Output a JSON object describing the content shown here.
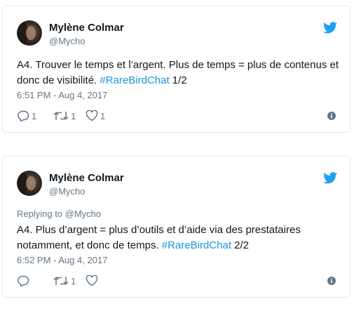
{
  "tweets": [
    {
      "author_name": "Mylène Colmar",
      "author_handle": "@Mycho",
      "replying_to": "",
      "text_before": "A4. Trouver le temps et l’argent. Plus de temps = plus de contenus et donc de visibilité. ",
      "hashtag": "#RareBirdChat",
      "text_after": " 1/2",
      "timestamp": "6:51 PM - Aug 4, 2017",
      "reply_count": "1",
      "retweet_count": "1",
      "like_count": "1"
    },
    {
      "author_name": "Mylène Colmar",
      "author_handle": "@Mycho",
      "replying_to": "Replying to @Mycho",
      "text_before": "A4. Plus d’argent = plus d’outils et d’aide via des prestataires notamment, et donc de temps. ",
      "hashtag": "#RareBirdChat",
      "text_after": " 2/2",
      "timestamp": "6:52 PM - Aug 4, 2017",
      "reply_count": "",
      "retweet_count": "1",
      "like_count": ""
    }
  ],
  "icons": {
    "brand": "twitter-bird-icon",
    "reply": "reply-icon",
    "retweet": "retweet-icon",
    "like": "heart-icon",
    "info": "info-icon"
  },
  "colors": {
    "twitter_blue": "#1da1f2",
    "hashtag": "#1b95e0",
    "secondary_text": "#657786",
    "border": "#e1e8ed"
  }
}
